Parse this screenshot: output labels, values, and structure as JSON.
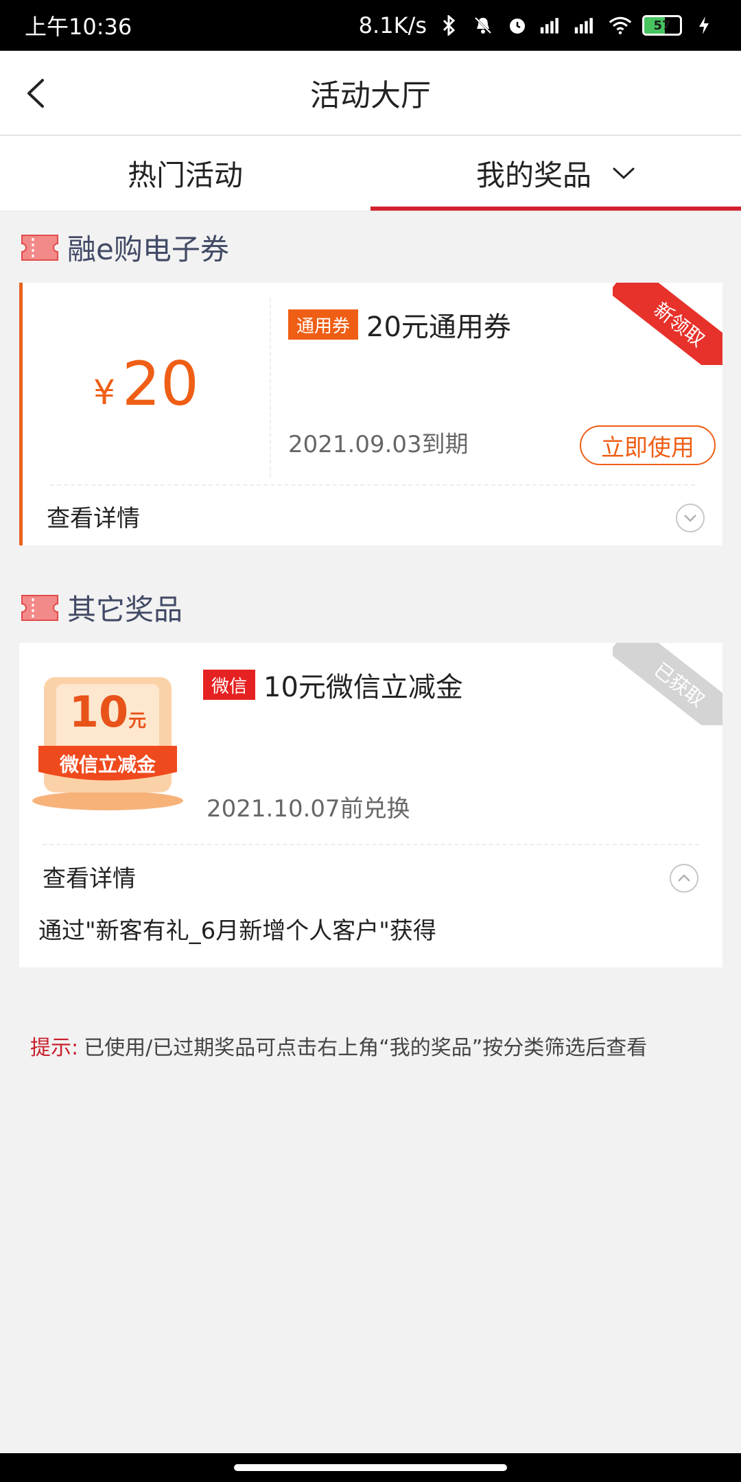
{
  "status_bar": {
    "time": "上午10:36",
    "speed": "8.1K/s",
    "battery": "57",
    "battery_level": 0.57
  },
  "header": {
    "title": "活动大厅"
  },
  "tabs": [
    {
      "label": "热门活动"
    },
    {
      "label": "我的奖品"
    }
  ],
  "section_coupons": {
    "title": "融e购电子券"
  },
  "coupon": {
    "currency_symbol": "¥",
    "amount": "20",
    "tag": "通用券",
    "title": "20元通用券",
    "expiry": "2021.09.03到期",
    "use_button": "立即使用",
    "ribbon": "新领取",
    "details_label": "查看详情"
  },
  "section_other": {
    "title": "其它奖品"
  },
  "reward": {
    "tag": "微信",
    "title": "10元微信立减金",
    "image_amount": "10",
    "image_unit": "元",
    "image_caption": "微信立减金",
    "expiry": "2021.10.07前兑换",
    "ribbon": "已获取",
    "details_label": "查看详情",
    "source_text": "通过\"新客有礼_6月新增个人客户\"获得"
  },
  "tip": {
    "label": "提示:",
    "text": "已使用/已过期奖品可点击右上角“我的奖品”按分类筛选后查看"
  },
  "colors": {
    "accent_red": "#d3222f",
    "orange": "#ef5e15",
    "tag_red": "#e62121"
  }
}
